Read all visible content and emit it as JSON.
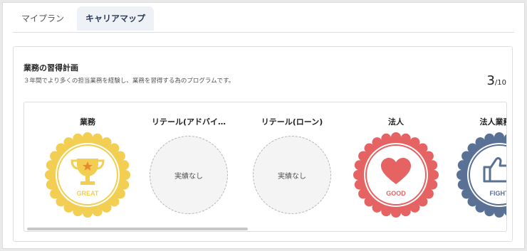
{
  "tabs": [
    {
      "label": "マイプラン"
    },
    {
      "label": "キャリアマップ"
    }
  ],
  "panel": {
    "title": "業務の習得計画",
    "description": "３年間でより多くの担当業務を経験し、業務を習得する為のプログラムです。",
    "counter_current": "3",
    "counter_total": "/10"
  },
  "badges": [
    {
      "label": "業務",
      "status": "earned",
      "badge_text": "GREAT",
      "color": "#f2cf52",
      "icon": "trophy-icon"
    },
    {
      "label": "リテール(アドバイ…",
      "status": "none",
      "empty_text": "実績なし"
    },
    {
      "label": "リテール(ローン)",
      "status": "none",
      "empty_text": "実績なし"
    },
    {
      "label": "法人",
      "status": "earned",
      "badge_text": "GOOD",
      "color": "#e56363",
      "icon": "heart-icon"
    },
    {
      "label": "法人業務コ",
      "status": "earned",
      "badge_text": "FIGHT",
      "color": "#5a7196",
      "icon": "thumbs-up-icon"
    }
  ]
}
